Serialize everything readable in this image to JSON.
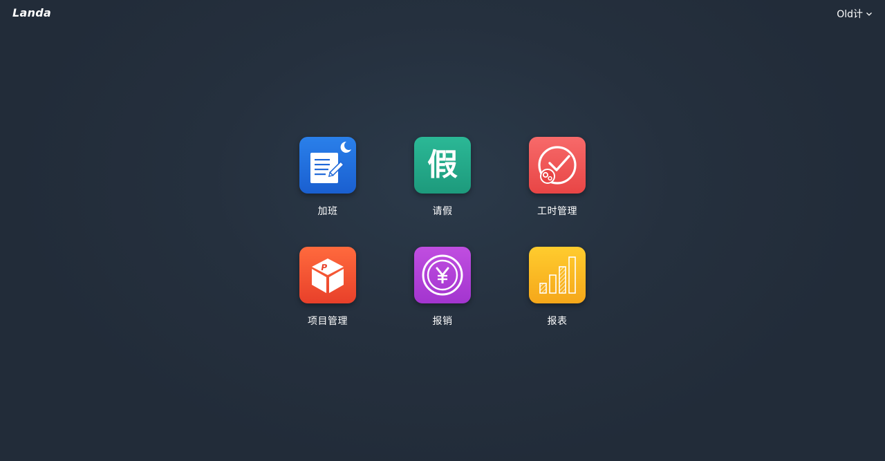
{
  "header": {
    "logo_text": "Landa",
    "user_name": "Old计"
  },
  "apps": [
    {
      "label": "加班",
      "icon": "overtime-icon",
      "color_top": "#2a80ea",
      "color_bottom": "#1a5fd0"
    },
    {
      "label": "请假",
      "icon": "leave-icon",
      "glyph": "假",
      "color_top": "#2bb896",
      "color_bottom": "#1d9a7c"
    },
    {
      "label": "工时管理",
      "icon": "clock-icon",
      "color_top": "#f76a6a",
      "color_bottom": "#e84545"
    },
    {
      "label": "项目管理",
      "icon": "project-box-icon",
      "color_top": "#ff6a3d",
      "color_bottom": "#e8402a"
    },
    {
      "label": "报销",
      "icon": "yen-coin-icon",
      "color_top": "#c04ee0",
      "color_bottom": "#a335cf"
    },
    {
      "label": "报表",
      "icon": "bar-chart-icon",
      "color_top": "#ffcc2e",
      "color_bottom": "#f5a71a"
    }
  ]
}
